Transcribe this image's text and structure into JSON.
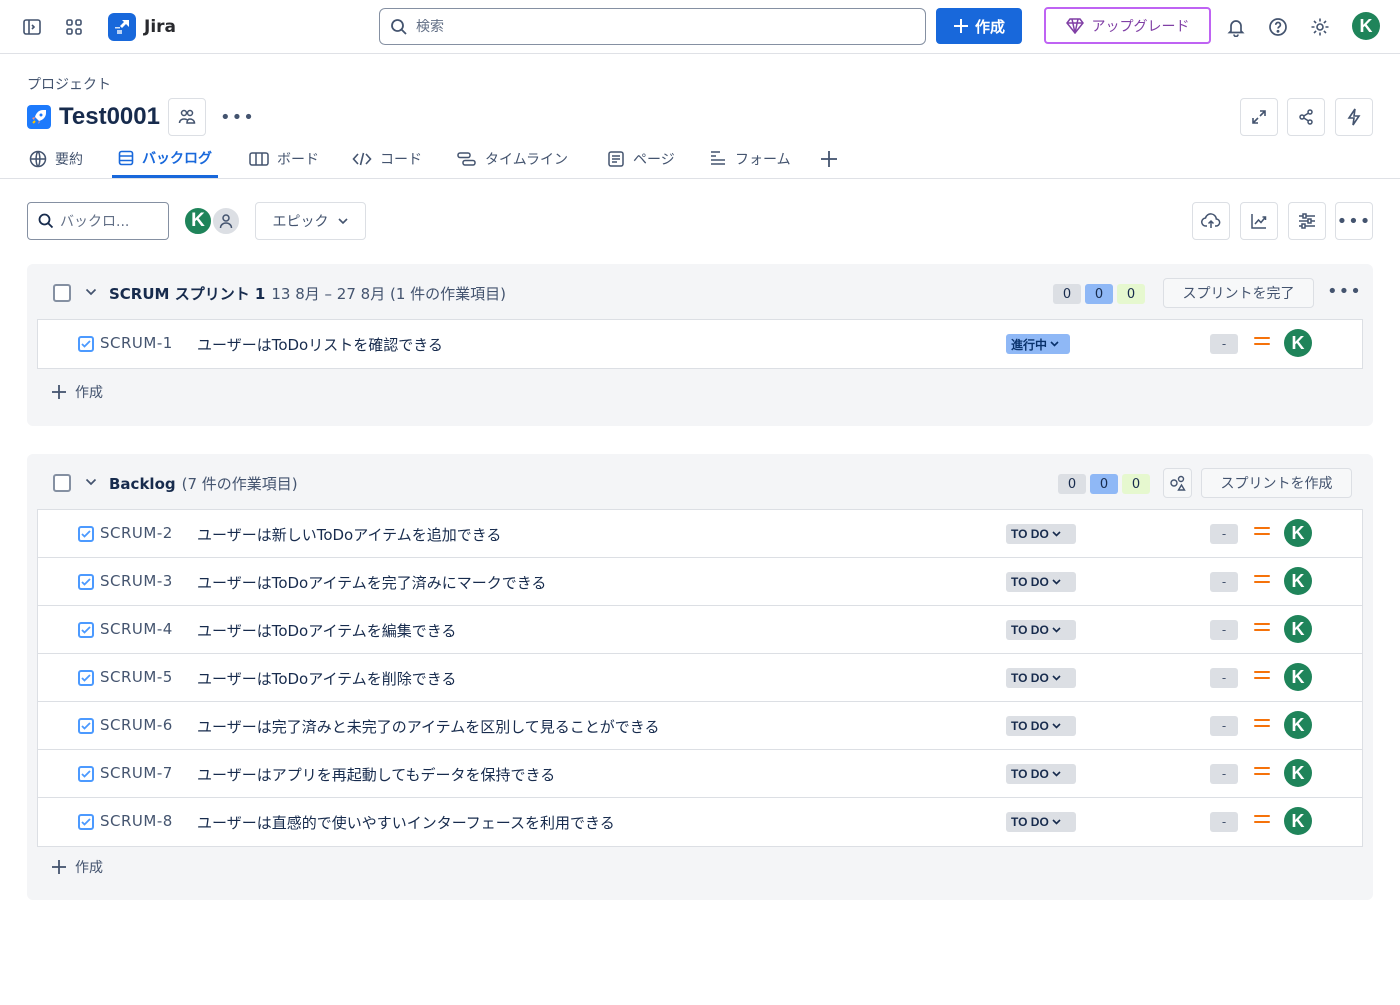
{
  "nav": {
    "app_name": "Jira",
    "search_placeholder": "検索",
    "create_label": "作成",
    "upgrade_label": "アップグレード",
    "avatar_letter": "K",
    "accent": "#1868db"
  },
  "project": {
    "breadcrumb": "プロジェクト",
    "title": "Test0001"
  },
  "tabs": [
    {
      "label": "要約",
      "icon": "globe-icon"
    },
    {
      "label": "バックログ",
      "icon": "backlog-icon"
    },
    {
      "label": "ボード",
      "icon": "board-icon"
    },
    {
      "label": "コード",
      "icon": "code-icon"
    },
    {
      "label": "タイムライン",
      "icon": "timeline-icon"
    },
    {
      "label": "ページ",
      "icon": "page-icon"
    },
    {
      "label": "フォーム",
      "icon": "form-icon"
    }
  ],
  "toolbar": {
    "search_placeholder": "バックロ...",
    "avatar_letter": "K",
    "epic_label": "エピック"
  },
  "sprint": {
    "name": "SCRUM スプリント 1",
    "meta": "13 8月 – 27 8月 (1 件の作業項目)",
    "counts": [
      "0",
      "0",
      "0"
    ],
    "complete_label": "スプリントを完了",
    "items": [
      {
        "key": "SCRUM-1",
        "summary": "ユーザーはToDoリストを確認できる",
        "status": "進行中",
        "estimate": "-",
        "avatar": "K"
      }
    ],
    "create_label": "作成"
  },
  "backlog": {
    "name": "Backlog",
    "meta": "(7 件の作業項目)",
    "counts": [
      "0",
      "0",
      "0"
    ],
    "create_sprint_label": "スプリントを作成",
    "items": [
      {
        "key": "SCRUM-2",
        "summary": "ユーザーは新しいToDoアイテムを追加できる",
        "status": "TO DO",
        "estimate": "-",
        "avatar": "K"
      },
      {
        "key": "SCRUM-3",
        "summary": "ユーザーはToDoアイテムを完了済みにマークできる",
        "status": "TO DO",
        "estimate": "-",
        "avatar": "K"
      },
      {
        "key": "SCRUM-4",
        "summary": "ユーザーはToDoアイテムを編集できる",
        "status": "TO DO",
        "estimate": "-",
        "avatar": "K"
      },
      {
        "key": "SCRUM-5",
        "summary": "ユーザーはToDoアイテムを削除できる",
        "status": "TO DO",
        "estimate": "-",
        "avatar": "K"
      },
      {
        "key": "SCRUM-6",
        "summary": "ユーザーは完了済みと未完了のアイテムを区別して見ることができる",
        "status": "TO DO",
        "estimate": "-",
        "avatar": "K"
      },
      {
        "key": "SCRUM-7",
        "summary": "ユーザーはアプリを再起動してもデータを保持できる",
        "status": "TO DO",
        "estimate": "-",
        "avatar": "K"
      },
      {
        "key": "SCRUM-8",
        "summary": "ユーザーは直感的で使いやすいインターフェースを利用できる",
        "status": "TO DO",
        "estimate": "-",
        "avatar": "K"
      }
    ],
    "create_label": "作成"
  }
}
